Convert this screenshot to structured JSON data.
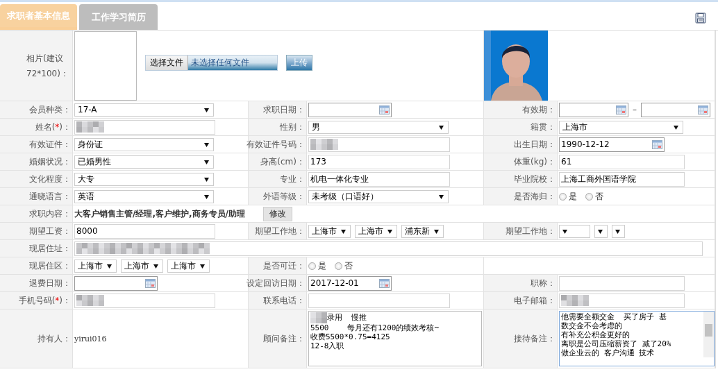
{
  "tabs": [
    {
      "label": "求职者基本信息",
      "selected": true
    },
    {
      "label": "工作学习简历",
      "selected": false
    }
  ],
  "photo_row": {
    "label": "相片(建议72*100)：",
    "file_button": "选择文件",
    "file_status": "未选择任何文件",
    "upload_button": "上传"
  },
  "rows": [
    {
      "cells": [
        {
          "label": "会员种类：",
          "kind": "select",
          "value": "17-A"
        },
        {
          "label": "求职日期：",
          "kind": "date"
        },
        {
          "label": "有效期：",
          "kind": "date_range",
          "separator": "–"
        }
      ]
    },
    {
      "cells": [
        {
          "label": "姓名(",
          "required_mark": "*",
          "label_end": ")：",
          "kind": "text",
          "redacted": true
        },
        {
          "label": "性别：",
          "kind": "select",
          "value": "男"
        },
        {
          "label": "籍贯：",
          "kind": "select",
          "value": "上海市"
        }
      ]
    },
    {
      "cells": [
        {
          "label": "有效证件：",
          "kind": "select",
          "value": "身份证"
        },
        {
          "label": "有效证件号码：",
          "kind": "text",
          "redacted": true
        },
        {
          "label": "出生日期：",
          "kind": "date",
          "value": "1990-12-12"
        }
      ]
    },
    {
      "cells": [
        {
          "label": "婚姻状况：",
          "kind": "select",
          "value": "已婚男性"
        },
        {
          "label": "身高(cm)：",
          "kind": "text",
          "value": "173"
        },
        {
          "label": "体重(kg)：",
          "kind": "text",
          "value": "61"
        }
      ]
    },
    {
      "cells": [
        {
          "label": "文化程度：",
          "kind": "select",
          "value": "大专"
        },
        {
          "label": "专业：",
          "kind": "text",
          "value": "机电一体化专业"
        },
        {
          "label": "毕业院校：",
          "kind": "text",
          "value": "上海工商外国语学院"
        }
      ]
    },
    {
      "cells": [
        {
          "label": "通晓语言：",
          "kind": "select",
          "value": "英语"
        },
        {
          "label": "外语等级：",
          "kind": "select",
          "value": "未考级（口语好）"
        },
        {
          "label": "是否海归：",
          "kind": "radio",
          "options": [
            {
              "label": "是",
              "selected": false
            },
            {
              "label": "否",
              "selected": false
            }
          ]
        }
      ]
    },
    {
      "cells": [
        {
          "label": "求职内容：",
          "kind": "job",
          "value": "大客户销售主管/经理,客户维护,商务专员/助理",
          "button": "修改"
        }
      ]
    },
    {
      "cells": [
        {
          "label": "期望工资：",
          "kind": "text",
          "value": "8000"
        },
        {
          "label": "期望工作地：",
          "kind": "selects",
          "items": [
            "上海市",
            "上海市",
            "浦东新"
          ]
        },
        {
          "label": "期望工作地：",
          "kind": "selects",
          "blank_items": [
            {
              "kind": "blank"
            },
            {
              "kind": "blank"
            },
            {
              "kind": "blank"
            }
          ]
        }
      ]
    },
    {
      "cells": [
        {
          "label": "现居住址：",
          "kind": "wide_text",
          "redacted": true
        }
      ]
    },
    {
      "cells": [
        {
          "label": "现居住区：",
          "kind": "selects",
          "items": [
            "上海市",
            "上海市",
            "上海市"
          ]
        },
        {
          "label": "是否可迁：",
          "kind": "radio",
          "options": [
            {
              "label": "是",
              "selected": false
            },
            {
              "label": "否",
              "selected": false
            }
          ]
        },
        {
          "kind": "empty"
        }
      ]
    },
    {
      "cells": [
        {
          "label": "退费日期：",
          "kind": "date"
        },
        {
          "label": "设定回访日期：",
          "kind": "date",
          "value": "2017-12-01"
        },
        {
          "label": "职称：",
          "kind": "text"
        }
      ]
    },
    {
      "cells": [
        {
          "label": "手机号码(",
          "required_mark": "*",
          "label_end": ")：",
          "kind": "text",
          "redacted": true
        },
        {
          "label": "联系电话：",
          "kind": "text"
        },
        {
          "label": "电子邮箱：",
          "kind": "text",
          "redacted": true
        }
      ]
    },
    {
      "cells": [
        {
          "label": "持有人：",
          "kind": "plain",
          "value": "yirui016"
        },
        {
          "label": "顾问备注：",
          "kind": "notes",
          "redacted_prefix": true,
          "lines": [
            "录用  慢推",
            "5500    每月还有1200的绩效考核~",
            "收费5500*0.75=4125",
            "12-8入职"
          ]
        },
        {
          "label": "接待备注：",
          "kind": "notes",
          "focused": true,
          "scrollbar": true,
          "lines": [
            "他需要全额交金  买了房子 基",
            "数交金不会考虑的",
            "有补充公积金更好的",
            "离职是公司压缩薪资了 减了20%",
            "做企业云的 客户沟通 技术"
          ]
        }
      ]
    }
  ]
}
